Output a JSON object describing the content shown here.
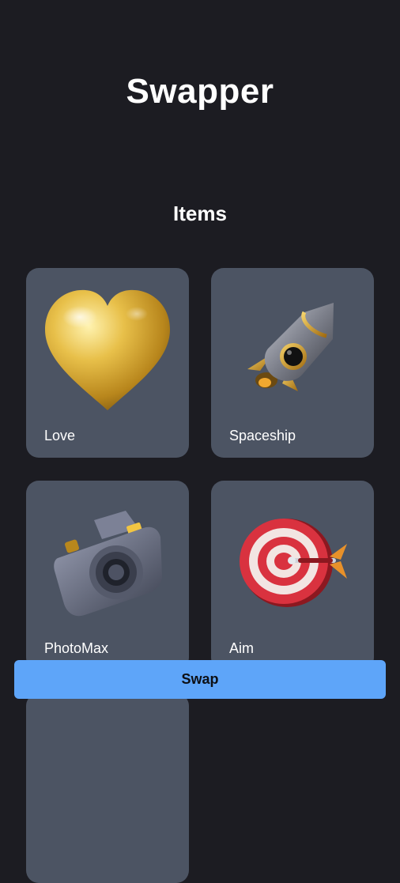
{
  "app": {
    "title": "Swapper"
  },
  "items_section": {
    "title": "Items",
    "items": [
      {
        "label": "Love",
        "icon": "gold-heart-icon"
      },
      {
        "label": "Spaceship",
        "icon": "rocket-icon"
      },
      {
        "label": "PhotoMax",
        "icon": "camera-icon"
      },
      {
        "label": "Aim",
        "icon": "dartboard-icon"
      }
    ]
  },
  "actions": {
    "swap_label": "Swap"
  },
  "colors": {
    "background": "#1c1c22",
    "card": "#4c5463",
    "accent": "#5ea5f9"
  }
}
